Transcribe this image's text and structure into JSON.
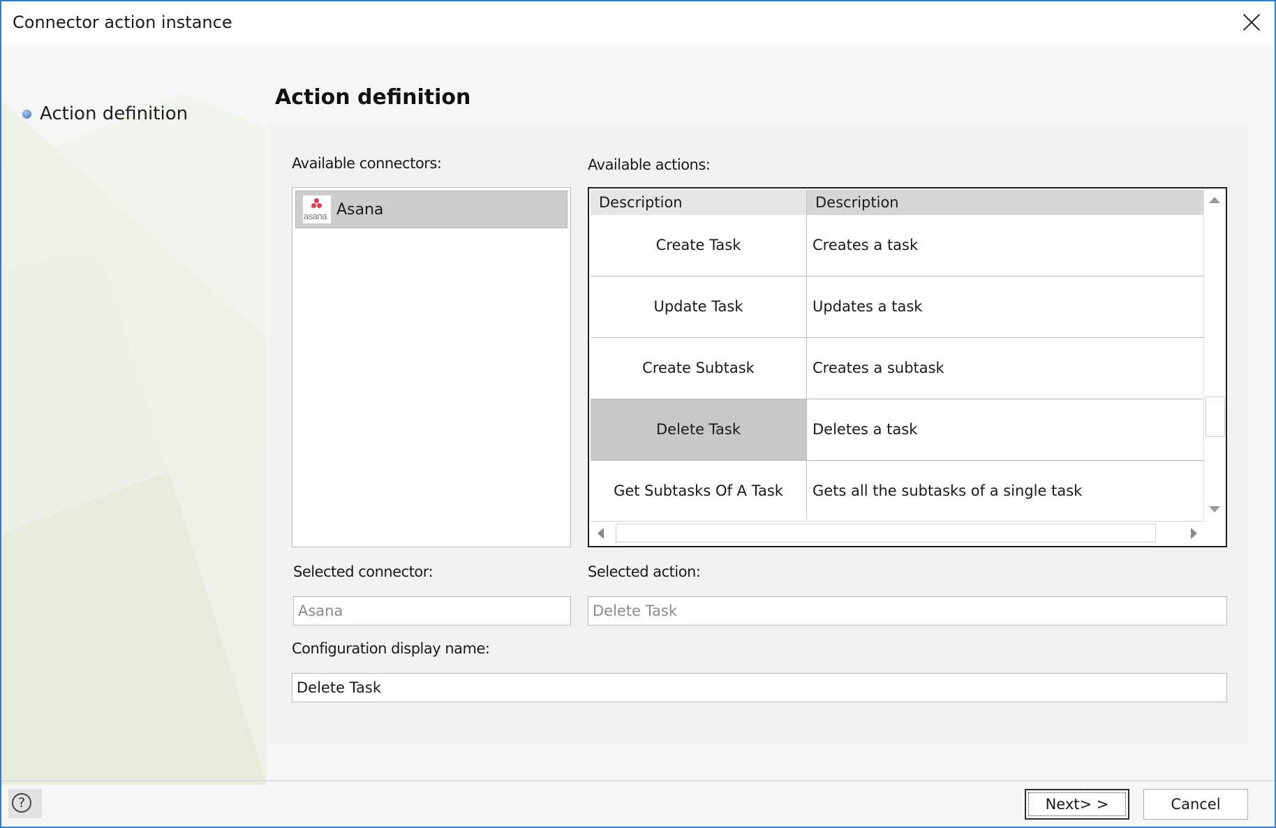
{
  "window": {
    "title": "Connector action instance"
  },
  "steps": [
    {
      "label": "Action definition"
    }
  ],
  "section": {
    "title": "Action definition"
  },
  "connectors": {
    "label": "Available connectors:",
    "items": [
      {
        "name": "Asana",
        "logo_text": "asana",
        "selected": true
      }
    ]
  },
  "actions": {
    "label": "Available actions:",
    "columns": [
      "Description",
      "Description"
    ],
    "rows": [
      {
        "name": "Create Task",
        "description": "Creates a task"
      },
      {
        "name": "Update Task",
        "description": "Updates a task"
      },
      {
        "name": "Create Subtask",
        "description": "Creates a subtask"
      },
      {
        "name": "Delete Task",
        "description": "Deletes a task",
        "selected": true
      },
      {
        "name": "Get Subtasks Of A Task",
        "description": "Gets all the subtasks of a single task"
      }
    ]
  },
  "selected_connector": {
    "label": "Selected connector:",
    "value": "Asana"
  },
  "selected_action": {
    "label": "Selected action:",
    "value": "Delete Task"
  },
  "display_name": {
    "label": "Configuration display name:",
    "value": "Delete Task"
  },
  "footer": {
    "help_symbol": "?",
    "next_label": "Next> >",
    "cancel_label": "Cancel"
  },
  "colors": {
    "window_border": "#2b7cd3",
    "selection_gray": "#c8c8c8",
    "asana_brand": "#e8384f"
  },
  "icons": [
    "close-icon",
    "help-icon",
    "asana-logo",
    "scroll-up-icon",
    "scroll-down-icon",
    "scroll-left-icon",
    "scroll-right-icon"
  ]
}
